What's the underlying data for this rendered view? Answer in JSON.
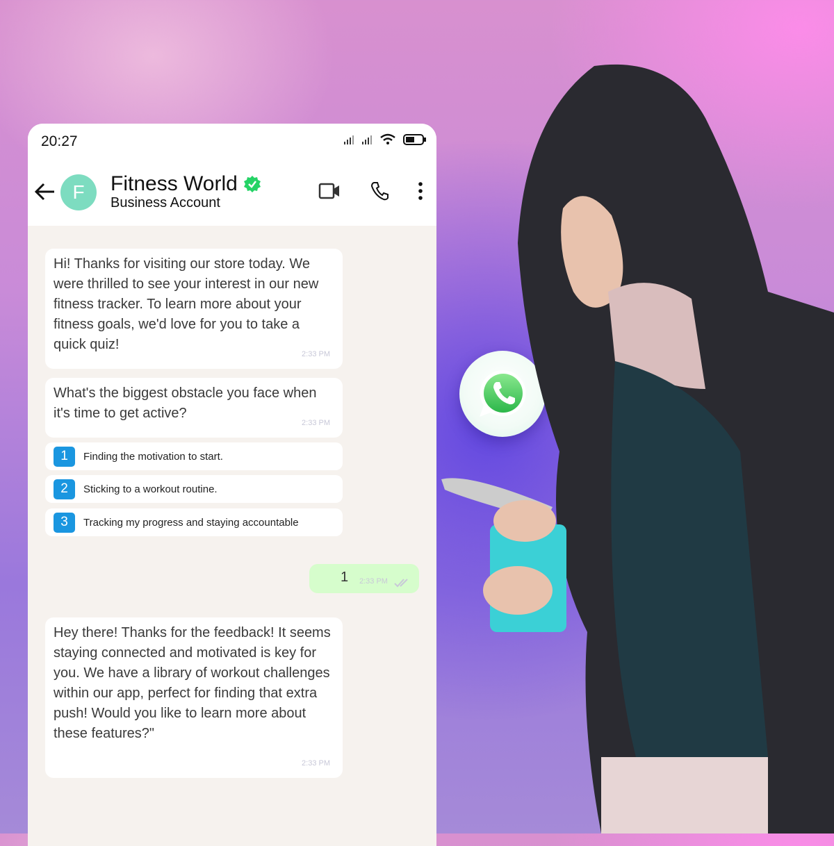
{
  "status_bar": {
    "time": "20:27",
    "icons": [
      "signal-icon",
      "signal-icon",
      "wifi-icon",
      "battery-icon"
    ]
  },
  "header": {
    "back_icon": "arrow-left-icon",
    "avatar_letter": "F",
    "title": "Fitness World",
    "verified_icon": "verified-badge-icon",
    "subtitle": "Business Account",
    "actions": [
      "video-call-icon",
      "phone-call-icon",
      "more-vertical-icon"
    ]
  },
  "messages": [
    {
      "from": "business",
      "text": "Hi! Thanks for visiting our store today. We were thrilled to see your interest in our new fitness tracker. To learn more about your fitness goals, we'd love for you to take a quick quiz!",
      "time": "2:33 PM"
    },
    {
      "from": "business",
      "text": "What's the biggest obstacle you face when it's time to get active?",
      "time": "2:33 PM"
    }
  ],
  "options": [
    {
      "number": "1",
      "label": "Finding the motivation to start."
    },
    {
      "number": "2",
      "label": "Sticking to a workout routine."
    },
    {
      "number": "3",
      "label": "Tracking my progress and staying accountable"
    }
  ],
  "reply": {
    "text": "1",
    "time": "2:33 PM",
    "status_icon": "double-check-icon"
  },
  "followup": {
    "text": "Hey there! Thanks for the feedback! It seems staying connected and motivated is key for you. We have a library of workout challenges within our app, perfect for finding that extra push! Would you like to learn more about these features?\"",
    "time": "2:33 PM"
  },
  "badge": {
    "icon": "whatsapp-icon"
  },
  "colors": {
    "accent_blue": "#1a96e0",
    "avatar": "#7ddcc0",
    "verified": "#25d366",
    "reply_bubble": "#d6fdcc",
    "chat_bg": "#f6f2ee"
  }
}
